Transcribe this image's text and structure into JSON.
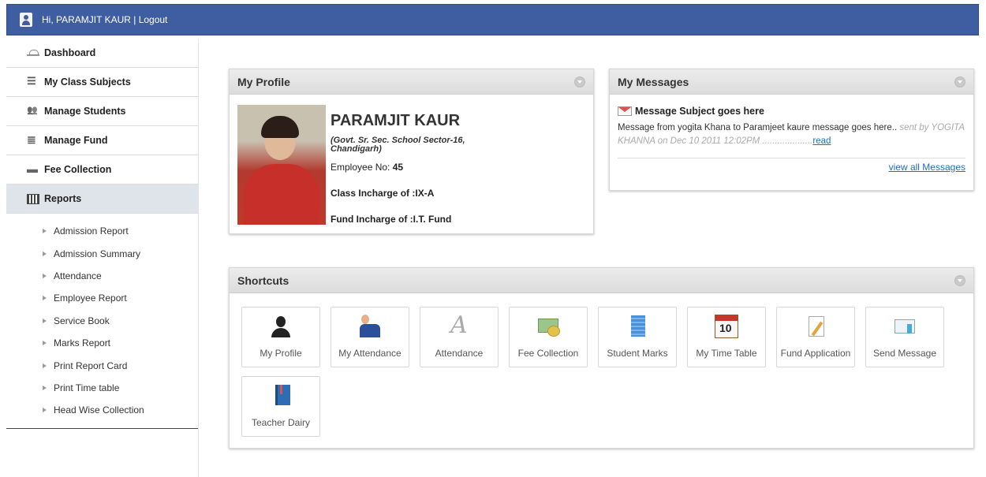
{
  "header": {
    "greeting": "Hi, PARAMJIT KAUR | Logout"
  },
  "sidebar": {
    "items": [
      {
        "label": "Dashboard",
        "icon": "dashboard-icon"
      },
      {
        "label": "My Class Subjects",
        "icon": "list-icon"
      },
      {
        "label": "Manage Students",
        "icon": "users-icon"
      },
      {
        "label": "Manage Fund",
        "icon": "fund-icon"
      },
      {
        "label": "Fee Collection",
        "icon": "fee-icon"
      },
      {
        "label": "Reports",
        "icon": "report-icon",
        "active": true
      }
    ],
    "report_links": [
      "Admission Report",
      "Admission Summary",
      "Attendance",
      "Employee Report",
      "Service Book",
      "Marks Report",
      "Print Report Card",
      "Print Time table",
      "Head Wise Collection"
    ]
  },
  "profile": {
    "title": "My Profile",
    "name": "PARAMJIT KAUR",
    "school": "(Govt. Sr. Sec. School Sector-16, Chandigarh)",
    "employee_label": "Employee No: ",
    "employee_no": "45",
    "class_incharge": "Class Incharge of :IX-A",
    "fund_incharge": "Fund Incharge of :I.T. Fund"
  },
  "messages": {
    "title": "My Messages",
    "subject": "Message Subject goes here",
    "body": "Message from yogita Khana to Paramjeet kaure message goes here.. ",
    "meta": "sent by YOGITA KHANNA on Dec 10 2011 12:02PM ....................",
    "read_link": "read",
    "view_all": "view all Messages"
  },
  "shortcuts": {
    "title": "Shortcuts",
    "items": [
      {
        "label": "My Profile",
        "icon": "person-icon"
      },
      {
        "label": "My Attendance",
        "icon": "attendance-person-icon"
      },
      {
        "label": "Attendance",
        "icon": "letter-a-icon"
      },
      {
        "label": "Fee Collection",
        "icon": "money-icon"
      },
      {
        "label": "Student Marks",
        "icon": "marks-sheet-icon"
      },
      {
        "label": "My Time Table",
        "icon": "calendar-icon"
      },
      {
        "label": "Fund Application",
        "icon": "document-edit-icon"
      },
      {
        "label": "Send Message",
        "icon": "mail-icon"
      },
      {
        "label": "Teacher Dairy",
        "icon": "book-icon"
      }
    ]
  },
  "colors": {
    "topbar": "#3f5da1",
    "link": "#1e6fbf",
    "active_nav": "#dfe3ea"
  }
}
